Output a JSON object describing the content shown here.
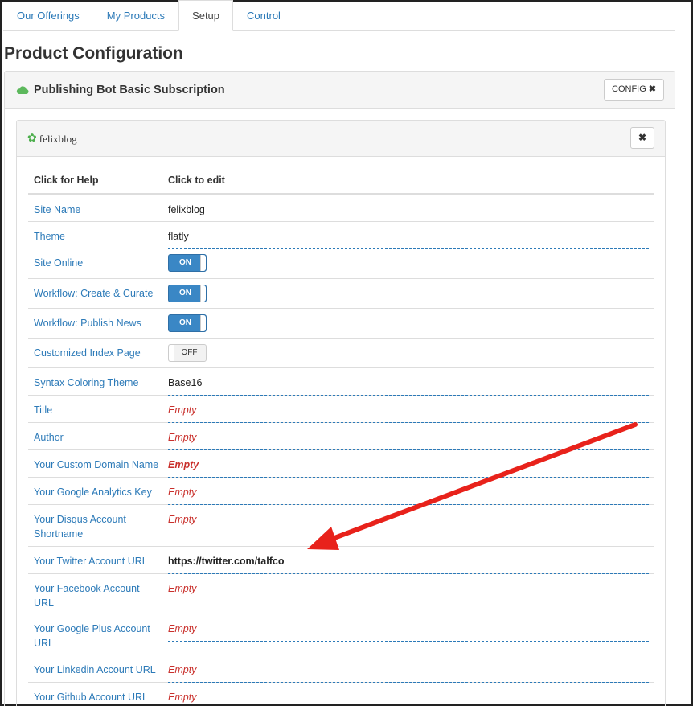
{
  "tabs": [
    {
      "label": "Our Offerings",
      "active": false
    },
    {
      "label": "My Products",
      "active": false
    },
    {
      "label": "Setup",
      "active": true
    },
    {
      "label": "Control",
      "active": false
    }
  ],
  "page_title": "Product Configuration",
  "panel": {
    "title": "Publishing Bot Basic Subscription",
    "config_label": "CONFIG",
    "close_glyph": "✖"
  },
  "site_panel": {
    "title": "felixblog",
    "close_glyph": "✖"
  },
  "table": {
    "headers": {
      "help": "Click for Help",
      "edit": "Click to edit"
    },
    "rows": [
      {
        "label": "Site Name",
        "value": "felixblog"
      },
      {
        "label": "Theme",
        "value": "flatly"
      },
      {
        "label": "Site Online",
        "toggle": "ON"
      },
      {
        "label": "Workflow: Create & Curate",
        "toggle": "ON"
      },
      {
        "label": "Workflow: Publish News",
        "toggle": "ON"
      },
      {
        "label": "Customized Index Page",
        "toggle": "OFF"
      },
      {
        "label": "Syntax Coloring Theme",
        "value": "Base16"
      },
      {
        "label": "Title",
        "value": "Empty"
      },
      {
        "label": "Author",
        "value": "Empty"
      },
      {
        "label": "Your Custom Domain Name",
        "value": "Empty"
      },
      {
        "label": "Your Google Analytics Key",
        "value": "Empty"
      },
      {
        "label": "Your Disqus Account Shortname",
        "value": "Empty"
      },
      {
        "label": "Your Twitter Account URL",
        "value": "https://twitter.com/talfco"
      },
      {
        "label": "Your Facebook Account URL",
        "value": "Empty"
      },
      {
        "label": "Your Google Plus Account URL",
        "value": "Empty"
      },
      {
        "label": "Your Linkedin Account URL",
        "value": "Empty"
      },
      {
        "label": "Your Github Account URL",
        "value": "Empty"
      }
    ]
  },
  "colors": {
    "link": "#2c7ab8",
    "empty": "#c9302c",
    "toggle_on": "#3a87c5",
    "arrow": "#e8221b"
  }
}
